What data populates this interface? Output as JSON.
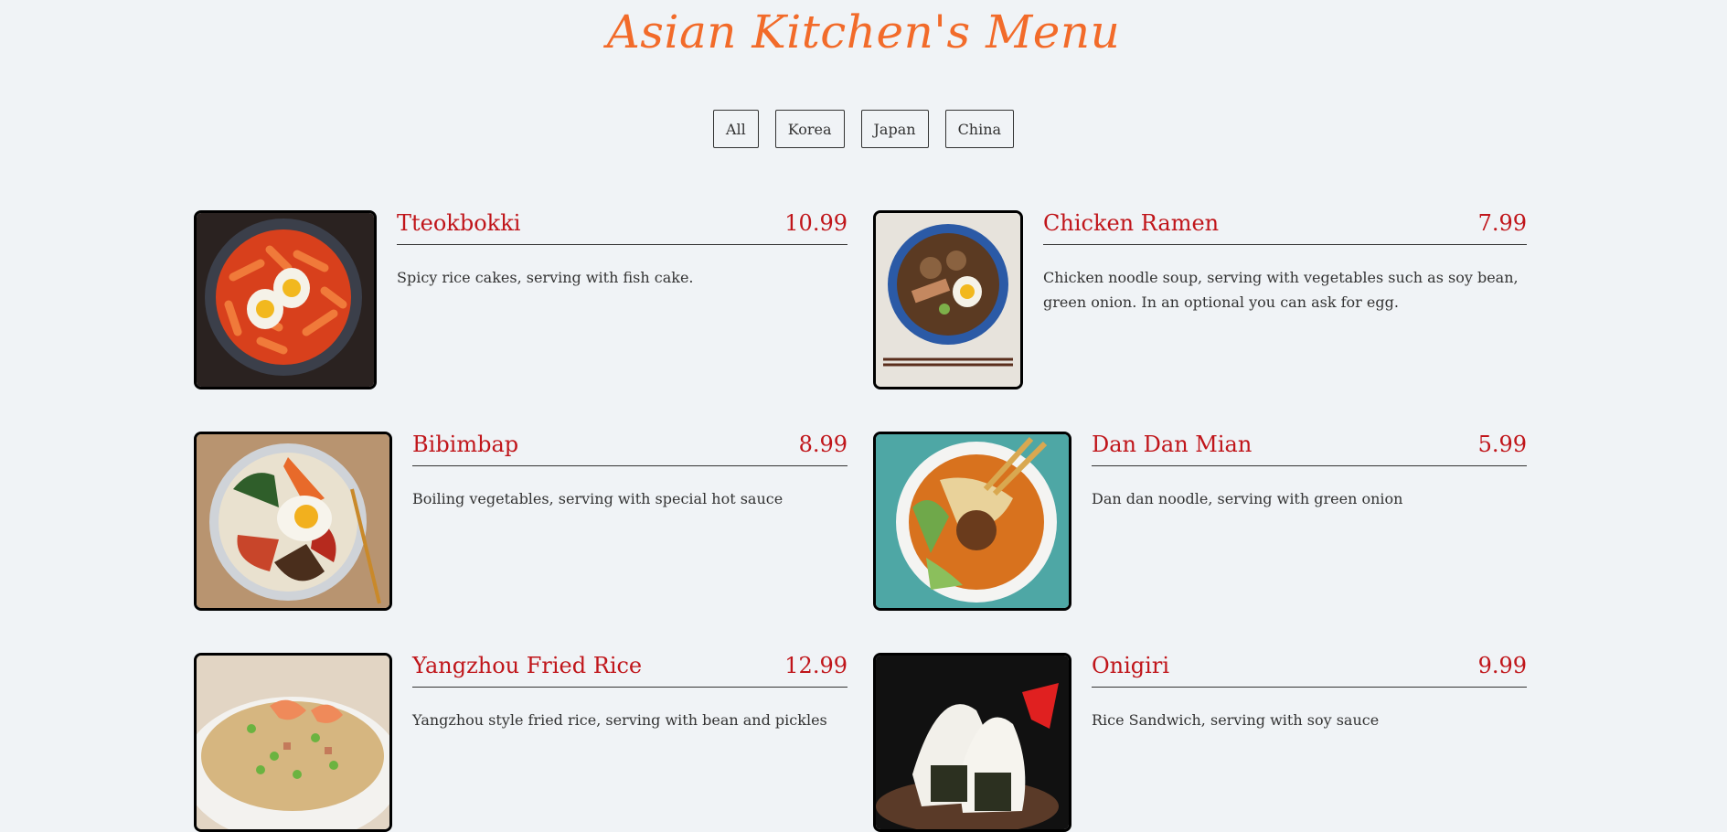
{
  "header": {
    "title": "Asian Kitchen's Menu"
  },
  "filters": [
    "All",
    "Korea",
    "Japan",
    "China"
  ],
  "items": [
    {
      "name": "Tteokbokki",
      "price": "10.99",
      "desc": "Spicy rice cakes, serving with fish cake.",
      "image": "tteokbokki-photo"
    },
    {
      "name": "Chicken Ramen",
      "price": "7.99",
      "desc": "Chicken noodle soup, serving with vegetables such as soy bean, green onion. In an optional you can ask for egg.",
      "image": "chicken-ramen-photo"
    },
    {
      "name": "Bibimbap",
      "price": "8.99",
      "desc": "Boiling vegetables, serving with special hot sauce",
      "image": "bibimbap-photo"
    },
    {
      "name": "Dan Dan Mian",
      "price": "5.99",
      "desc": "Dan dan noodle, serving with green onion",
      "image": "dan-dan-mian-photo"
    },
    {
      "name": "Yangzhou Fried Rice",
      "price": "12.99",
      "desc": "Yangzhou style fried rice, serving with bean and pickles",
      "image": "fried-rice-photo"
    },
    {
      "name": "Onigiri",
      "price": "9.99",
      "desc": "Rice Sandwich, serving with soy sauce",
      "image": "onigiri-photo"
    }
  ],
  "colors": {
    "accent": "#f26b2a",
    "price": "#c0151a",
    "background": "#f0f3f6"
  }
}
